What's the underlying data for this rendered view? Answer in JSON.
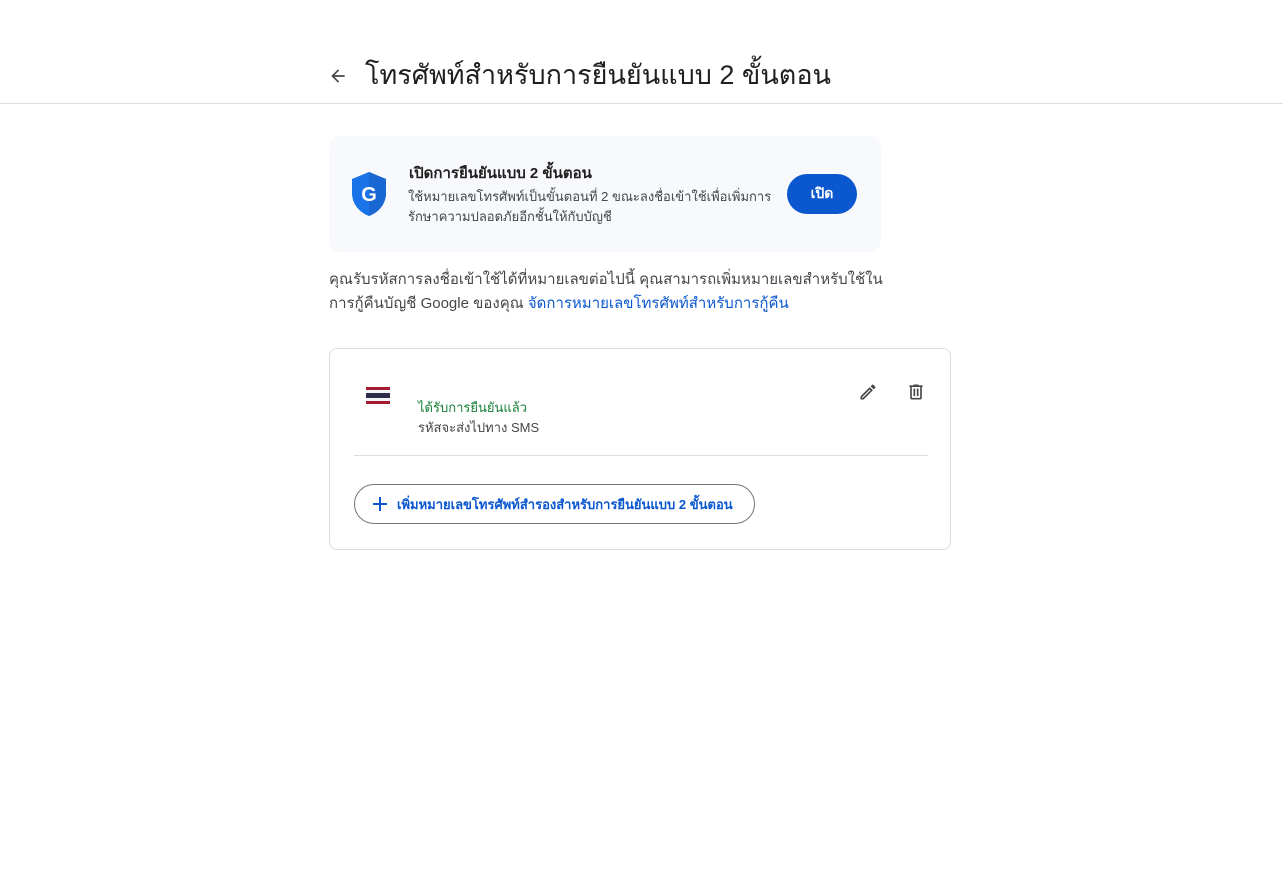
{
  "header": {
    "title": "โทรศัพท์สำหรับการยืนยันแบบ 2 ขั้นตอน",
    "back_icon": "arrow-back-icon"
  },
  "promo": {
    "title": "เปิดการยืนยันแบบ 2 ขั้นตอน",
    "description": "ใช้หมายเลขโทรศัพท์เป็นขั้นตอนที่ 2 ขณะลงชื่อเข้าใช้เพื่อเพิ่มการรักษาความปลอดภัยอีกชั้นให้กับบัญชี",
    "button_label": "เปิด",
    "icon": "google-shield-icon",
    "accent_color": "#0b57d0"
  },
  "info": {
    "text": "คุณรับรหัสการลงชื่อเข้าใช้ได้ที่หมายเลขต่อไปนี้ คุณสามารถเพิ่มหมายเลขสำหรับใช้ในการกู้คืนบัญชี Google ของคุณ ",
    "link_text": "จัดการหมายเลขโทรศัพท์สำหรับการกู้คืน"
  },
  "phone": {
    "country_flag": "thailand-flag-icon",
    "status": "ได้รับการยืนยันแล้ว",
    "status_color": "#188038",
    "delivery": "รหัสจะส่งไปทาง SMS",
    "edit_icon": "pencil-icon",
    "delete_icon": "trash-icon"
  },
  "add_backup": {
    "label": "เพิ่มหมายเลขโทรศัพท์สำรองสำหรับการยืนยันแบบ 2 ขั้นตอน",
    "icon": "plus-icon"
  }
}
